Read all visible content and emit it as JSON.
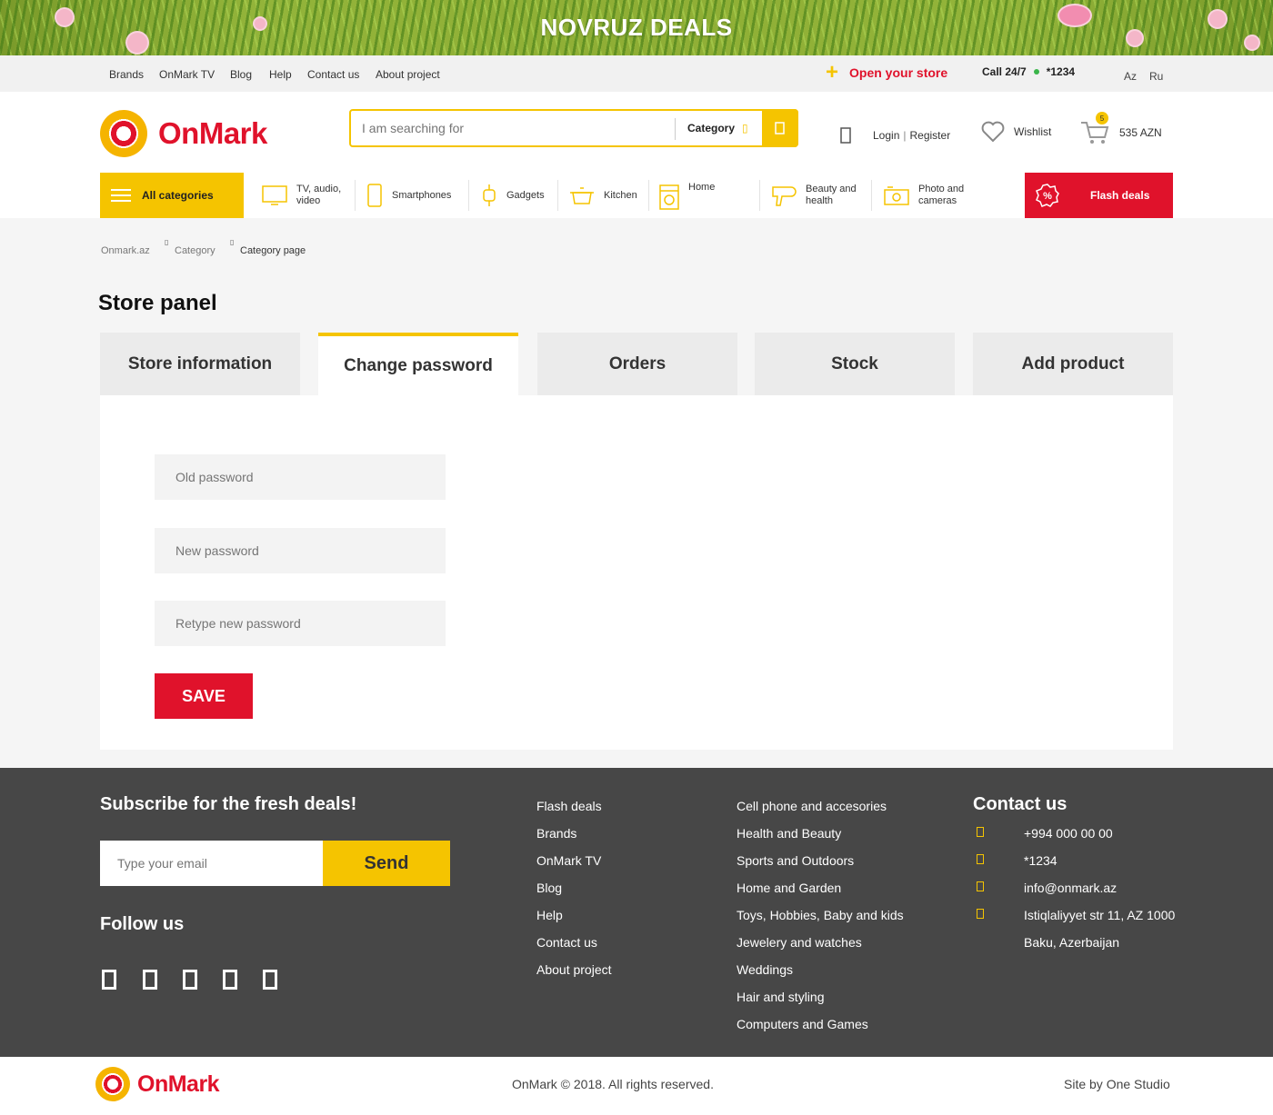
{
  "banner": {
    "title": "NOVRUZ DEALS"
  },
  "topbar": {
    "links": [
      "Brands",
      "OnMark TV",
      "Blog",
      "Help",
      "Contact us",
      "About project"
    ],
    "open_store": "Open your store",
    "call_label": "Call 24/7",
    "call_number": "*1234",
    "languages": [
      "Az",
      "Ru"
    ]
  },
  "header": {
    "logo": "OnMark",
    "search_placeholder": "I am searching for",
    "category_label": "Category",
    "login": "Login",
    "separator": "|",
    "register": "Register",
    "wishlist": "Wishlist",
    "cart_count": "5",
    "cart_total": "535 AZN"
  },
  "nav": {
    "all_categories": "All categories",
    "categories": [
      {
        "label": "TV, audio, video",
        "icon": "tv-icon"
      },
      {
        "label": "Smartphones",
        "icon": "smartphone-icon"
      },
      {
        "label": "Gadgets",
        "icon": "smartwatch-icon"
      },
      {
        "label": "Kitchen",
        "icon": "pot-icon"
      },
      {
        "label": "Home",
        "icon": "washing-machine-icon"
      },
      {
        "label": "Beauty and health",
        "icon": "hairdryer-icon"
      },
      {
        "label": "Photo and cameras",
        "icon": "camera-icon"
      }
    ],
    "flash_deals": "Flash deals"
  },
  "breadcrumb": [
    "Onmark.az",
    "Category",
    "Category page"
  ],
  "page_title": "Store panel",
  "tabs": [
    {
      "label": "Store information",
      "active": false
    },
    {
      "label": "Change password",
      "active": true
    },
    {
      "label": "Orders",
      "active": false
    },
    {
      "label": "Stock",
      "active": false
    },
    {
      "label": "Add product",
      "active": false
    }
  ],
  "form": {
    "old_password": "Old password",
    "new_password": "New password",
    "retype_password": "Retype new password",
    "save": "SAVE"
  },
  "footer": {
    "subscribe_title": "Subscribe for the fresh deals!",
    "email_placeholder": "Type your email",
    "send": "Send",
    "follow_title": "Follow us",
    "social_icons": [
      "facebook-icon",
      "instagram-icon",
      "twitter-icon",
      "youtube-icon",
      "linkedin-icon"
    ],
    "links_col1": [
      "Flash deals",
      "Brands",
      "OnMark TV",
      "Blog",
      "Help",
      "Contact us",
      "About project"
    ],
    "links_col2": [
      "Cell phone and accesories",
      "Health and Beauty",
      "Sports and Outdoors",
      "Home and Garden",
      "Toys, Hobbies, Baby and kids",
      "Jewelery and watches",
      "Weddings",
      "Hair and styling",
      "Computers and Games"
    ],
    "contact_title": "Contact us",
    "contacts": [
      "+994 000 00 00",
      "*1234",
      "info@onmark.az",
      "Istiqlaliyyet str 11, AZ 1000",
      "Baku, Azerbaijan"
    ]
  },
  "bottom": {
    "logo": "OnMark",
    "copyright": "OnMark © 2018. All rights reserved.",
    "credit": "Site by One Studio"
  },
  "colors": {
    "accent": "#f5c400",
    "brand_red": "#e0122b",
    "footer_bg": "#474747"
  }
}
